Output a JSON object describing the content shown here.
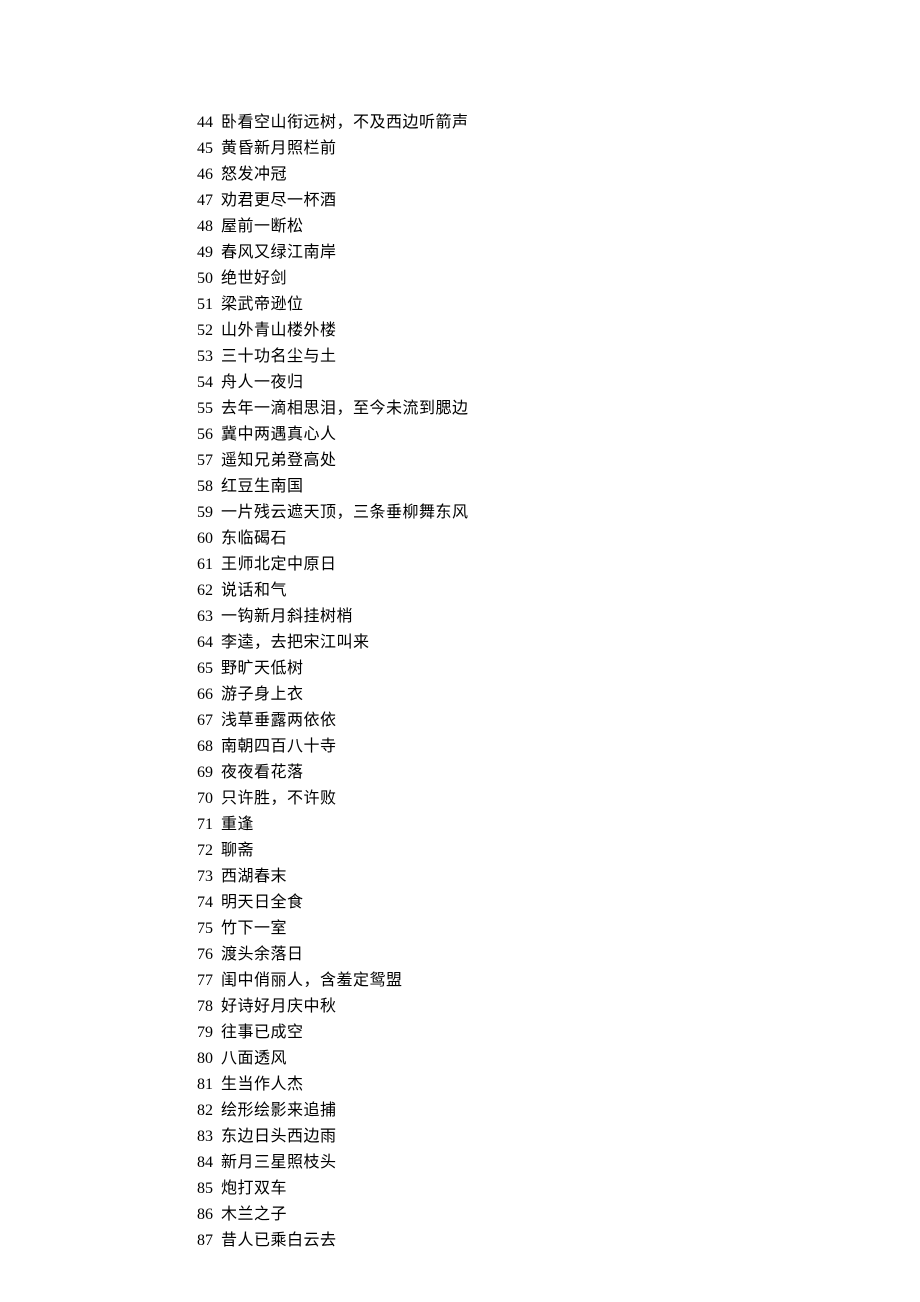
{
  "entries": [
    {
      "num": "44",
      "text": "卧看空山衔远树，不及西边听箭声"
    },
    {
      "num": "45",
      "text": "黄昏新月照栏前"
    },
    {
      "num": "46",
      "text": "怒发冲冠"
    },
    {
      "num": "47",
      "text": "劝君更尽一杯酒"
    },
    {
      "num": "48",
      "text": "屋前一断松"
    },
    {
      "num": "49",
      "text": "春风又绿江南岸"
    },
    {
      "num": "50",
      "text": "绝世好剑"
    },
    {
      "num": "51",
      "text": "梁武帝逊位"
    },
    {
      "num": "52",
      "text": "山外青山楼外楼"
    },
    {
      "num": "53",
      "text": "三十功名尘与土"
    },
    {
      "num": "54",
      "text": "舟人一夜归"
    },
    {
      "num": "55",
      "text": "去年一滴相思泪，至今未流到腮边"
    },
    {
      "num": "56",
      "text": "冀中两遇真心人"
    },
    {
      "num": "57",
      "text": "遥知兄弟登高处"
    },
    {
      "num": "58",
      "text": "红豆生南国"
    },
    {
      "num": "59",
      "text": "一片残云遮天顶，三条垂柳舞东风"
    },
    {
      "num": "60",
      "text": "东临碣石"
    },
    {
      "num": "61",
      "text": "王师北定中原日"
    },
    {
      "num": "62",
      "text": "说话和气"
    },
    {
      "num": "63",
      "text": "一钩新月斜挂树梢"
    },
    {
      "num": "64",
      "text": "李逵，去把宋江叫来"
    },
    {
      "num": "65",
      "text": "野旷天低树"
    },
    {
      "num": "66",
      "text": "游子身上衣"
    },
    {
      "num": "67",
      "text": "浅草垂露两依依"
    },
    {
      "num": "68",
      "text": "南朝四百八十寺"
    },
    {
      "num": "69",
      "text": "夜夜看花落"
    },
    {
      "num": "70",
      "text": "只许胜，不许败"
    },
    {
      "num": "71",
      "text": "重逢"
    },
    {
      "num": "72",
      "text": "聊斋"
    },
    {
      "num": "73",
      "text": "西湖春末"
    },
    {
      "num": "74",
      "text": "明天日全食"
    },
    {
      "num": "75",
      "text": "竹下一室"
    },
    {
      "num": "76",
      "text": "渡头余落日"
    },
    {
      "num": "77",
      "text": "闺中俏丽人，含羞定鸳盟"
    },
    {
      "num": "78",
      "text": "好诗好月庆中秋"
    },
    {
      "num": "79",
      "text": "往事已成空"
    },
    {
      "num": "80",
      "text": "八面透风"
    },
    {
      "num": "81",
      "text": "生当作人杰"
    },
    {
      "num": "82",
      "text": "绘形绘影来追捕"
    },
    {
      "num": "83",
      "text": "东边日头西边雨"
    },
    {
      "num": "84",
      "text": "新月三星照枝头"
    },
    {
      "num": "85",
      "text": "炮打双车"
    },
    {
      "num": "86",
      "text": "木兰之子"
    },
    {
      "num": "87",
      "text": "昔人已乘白云去"
    }
  ]
}
